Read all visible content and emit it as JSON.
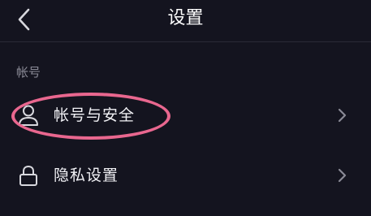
{
  "header": {
    "title": "设置",
    "back_icon": "chevron-left-icon"
  },
  "sections": [
    {
      "label": "帐号",
      "items": [
        {
          "label": "帐号与安全",
          "icon": "user-icon"
        },
        {
          "label": "隐私设置",
          "icon": "lock-icon"
        }
      ]
    }
  ],
  "colors": {
    "background": "#14141f",
    "text": "#ffffff",
    "section_label": "#8a8a96",
    "highlight": "#e9678f"
  }
}
